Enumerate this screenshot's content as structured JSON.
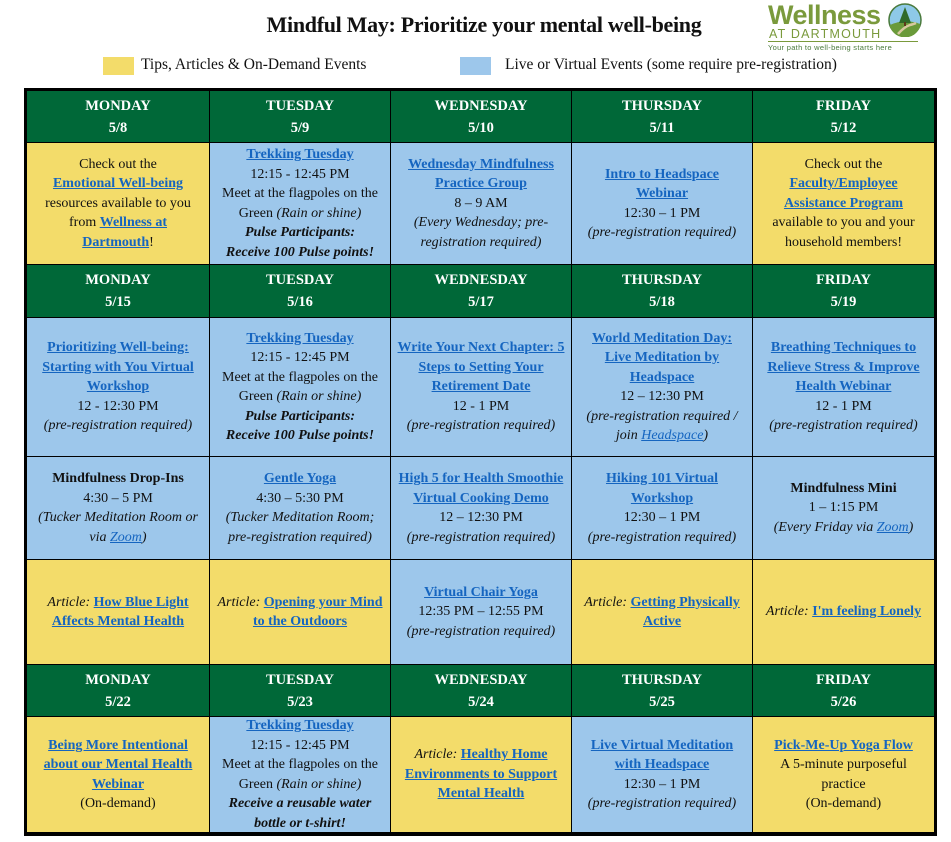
{
  "header": {
    "title": "Mindful May: Prioritize your mental well-being",
    "logo": {
      "wordmark": "Wellness",
      "subtitle": "AT DARTMOUTH",
      "tagline": "Your path to well-being starts here",
      "icon": "tree-path-emblem-icon"
    }
  },
  "legend": [
    {
      "label": "Tips, Articles & On-Demand Events",
      "color": "#f3dc6a"
    },
    {
      "label": "Live or Virtual Events (some require pre-registration)",
      "color": "#9dc7eb"
    }
  ],
  "colors": {
    "header_green": "#006838",
    "tips_yellow": "#f3dc6a",
    "events_blue": "#9dc7eb",
    "link_blue": "#1565c0"
  },
  "weeks": [
    {
      "days": [
        {
          "day": "MONDAY",
          "date": "5/8"
        },
        {
          "day": "TUESDAY",
          "date": "5/9"
        },
        {
          "day": "WEDNESDAY",
          "date": "5/10"
        },
        {
          "day": "THURSDAY",
          "date": "5/11"
        },
        {
          "day": "FRIDAY",
          "date": "5/12"
        }
      ]
    },
    {
      "days": [
        {
          "day": "MONDAY",
          "date": "5/15"
        },
        {
          "day": "TUESDAY",
          "date": "5/16"
        },
        {
          "day": "WEDNESDAY",
          "date": "5/17"
        },
        {
          "day": "THURSDAY",
          "date": "5/18"
        },
        {
          "day": "FRIDAY",
          "date": "5/19"
        }
      ]
    },
    {
      "days": [
        {
          "day": "MONDAY",
          "date": "5/22"
        },
        {
          "day": "TUESDAY",
          "date": "5/23"
        },
        {
          "day": "WEDNESDAY",
          "date": "5/24"
        },
        {
          "day": "THURSDAY",
          "date": "5/25"
        },
        {
          "day": "FRIDAY",
          "date": "5/26"
        }
      ]
    }
  ],
  "cells": {
    "w1_mon": {
      "pre": "Check out the",
      "link1": "Emotional Well-being",
      "mid": "resources available to you from",
      "link2": "Wellness at Dartmouth",
      "post": "!"
    },
    "w1_tue": {
      "link": "Trekking Tuesday",
      "time": "12:15 - 12:45 PM",
      "loc": "Meet at the flagpoles on the Green",
      "note": "(Rain or shine)",
      "bonus1": "Pulse Participants:",
      "bonus2": "Receive 100 Pulse points!"
    },
    "w1_wed": {
      "link": "Wednesday Mindfulness Practice Group",
      "time": "8 – 9 AM",
      "note": "(Every Wednesday; pre-registration required)"
    },
    "w1_thu": {
      "link": "Intro to Headspace Webinar",
      "time": "12:30 – 1 PM",
      "note": "(pre-registration required)"
    },
    "w1_fri": {
      "pre": "Check out the",
      "link": "Faculty/Employee Assistance Program",
      "post": "available to you and your household members!"
    },
    "w2a_mon": {
      "link": "Prioritizing Well-being: Starting with You Virtual Workshop",
      "time": "12 - 12:30 PM",
      "note": "(pre-registration required)"
    },
    "w2a_tue": {
      "link": "Trekking Tuesday",
      "time": "12:15 - 12:45 PM",
      "loc": "Meet at the flagpoles on the Green",
      "note": "(Rain or shine)",
      "bonus1": "Pulse Participants:",
      "bonus2": "Receive 100 Pulse points!"
    },
    "w2a_wed": {
      "link": "Write Your Next Chapter: 5 Steps to Setting Your Retirement Date",
      "time": "12 - 1 PM",
      "note": "(pre-registration required)"
    },
    "w2a_thu": {
      "link": "World Meditation Day: Live Meditation by Headspace",
      "time": "12 – 12:30 PM",
      "note_pre": "(pre-registration required / join",
      "note_link": "Headspace",
      "note_post": ")"
    },
    "w2a_fri": {
      "link": "Breathing Techniques to Relieve Stress & Improve Health Webinar",
      "time": "12 - 1 PM",
      "note": "(pre-registration required)"
    },
    "w2b_mon": {
      "title": "Mindfulness Drop-Ins",
      "time": "4:30 – 5 PM",
      "note_pre": "(Tucker Meditation Room or via",
      "note_link": "Zoom",
      "note_post": ")"
    },
    "w2b_tue": {
      "link": "Gentle Yoga",
      "time": "4:30 – 5:30 PM",
      "note": "(Tucker Meditation Room; pre-registration required)"
    },
    "w2b_wed": {
      "link": "High 5 for Health Smoothie Virtual Cooking Demo",
      "time": "12 – 12:30 PM",
      "note": "(pre-registration required)"
    },
    "w2b_thu": {
      "link": "Hiking 101 Virtual Workshop",
      "time": "12:30 – 1 PM",
      "note": "(pre-registration required)"
    },
    "w2b_fri": {
      "title": "Mindfulness Mini",
      "time": "1 – 1:15 PM",
      "note_pre": "(Every Friday via",
      "note_link": "Zoom",
      "note_post": ")"
    },
    "w2c_mon": {
      "prefix": "Article:",
      "link": "How Blue Light Affects Mental Health"
    },
    "w2c_tue": {
      "prefix": "Article:",
      "link": "Opening your Mind to the Outdoors"
    },
    "w2c_wed": {
      "link": "Virtual Chair Yoga",
      "time": "12:35 PM – 12:55 PM",
      "note": "(pre-registration required)"
    },
    "w2c_thu": {
      "prefix": "Article:",
      "link": "Getting Physically Active"
    },
    "w2c_fri": {
      "prefix": "Article:",
      "link": "I'm feeling Lonely"
    },
    "w3_mon": {
      "link": "Being More Intentional about our Mental Health Webinar",
      "note": "(On-demand)"
    },
    "w3_tue": {
      "link": "Trekking Tuesday",
      "time": "12:15 - 12:45 PM",
      "loc": "Meet at the flagpoles on the Green",
      "note": "(Rain or shine)",
      "bonus": "Receive a reusable water bottle or t-shirt!"
    },
    "w3_wed": {
      "prefix": "Article:",
      "link": "Healthy Home Environments to Support Mental Health"
    },
    "w3_thu": {
      "link": "Live Virtual Meditation with Headspace",
      "time": "12:30 – 1 PM",
      "note": "(pre-registration required)"
    },
    "w3_fri": {
      "link": "Pick-Me-Up Yoga Flow",
      "desc": "A 5-minute purposeful practice",
      "note": "(On-demand)"
    }
  }
}
